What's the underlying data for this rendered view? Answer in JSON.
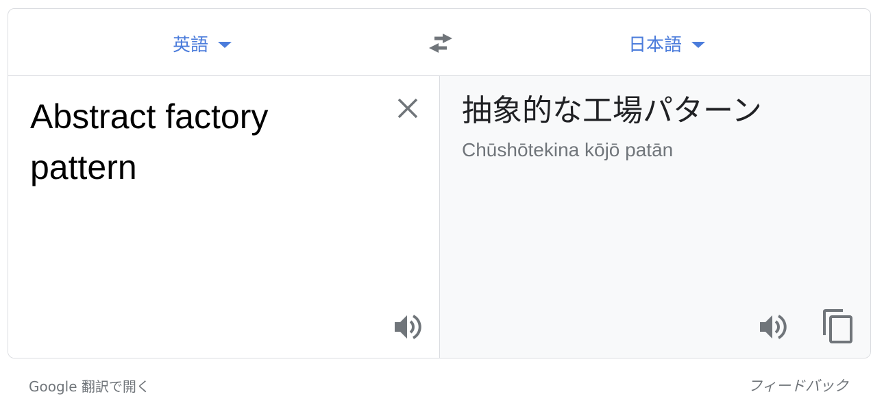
{
  "languages": {
    "source": "英語",
    "target": "日本語"
  },
  "icons": {
    "swap": "swap-arrows-icon",
    "clear": "close-icon",
    "speaker": "speaker-icon",
    "copy": "copy-icon"
  },
  "source": {
    "text": "Abstract factory pattern"
  },
  "target": {
    "text": "抽象的な工場パターン",
    "romanization": "Chūshōtekina kōjō patān"
  },
  "footer": {
    "open_link": "Google 翻訳で開く",
    "feedback": "フィードバック"
  },
  "colors": {
    "accent": "#4b7cdb",
    "icon": "#70757a",
    "target_bg": "#f8f9fa",
    "border": "#dadce0"
  }
}
